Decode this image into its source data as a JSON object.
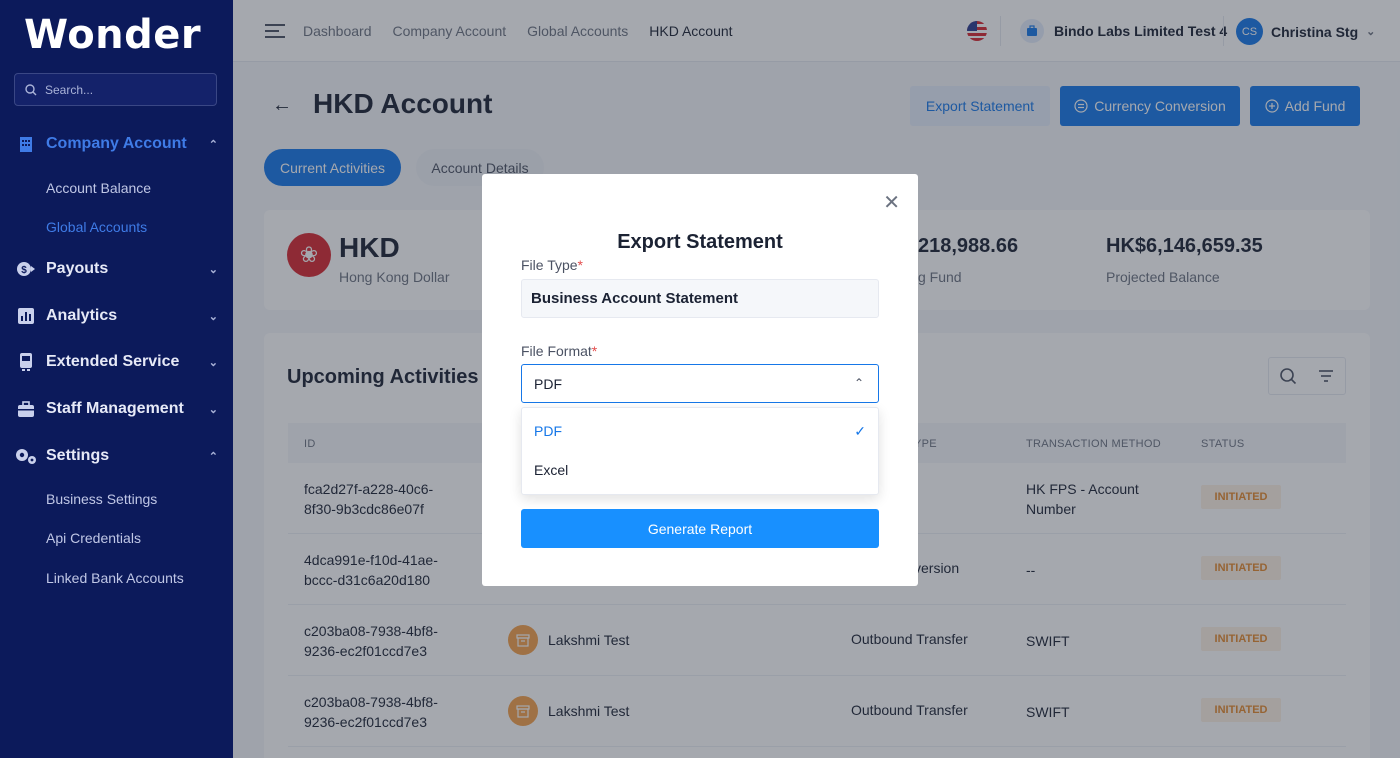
{
  "sidebar": {
    "logo": "Wonder",
    "search_placeholder": "Search...",
    "items": [
      {
        "label": "Company Account",
        "icon": "building-icon",
        "expanded": true
      },
      {
        "label": "Payouts",
        "icon": "money-icon"
      },
      {
        "label": "Analytics",
        "icon": "chart-icon"
      },
      {
        "label": "Extended Service",
        "icon": "service-icon"
      },
      {
        "label": "Staff Management",
        "icon": "staff-icon"
      },
      {
        "label": "Settings",
        "icon": "gears-icon",
        "expanded": true
      }
    ],
    "company_sub": [
      "Account Balance",
      "Global Accounts"
    ],
    "settings_sub": [
      "Business Settings",
      "Api Credentials",
      "Linked Bank Accounts"
    ]
  },
  "topbar": {
    "breadcrumbs": [
      "Dashboard",
      "Company Account",
      "Global Accounts",
      "HKD Account"
    ],
    "business": "Bindo Labs Limited Test 4",
    "user_initials": "CS",
    "user_name": "Christina Stg"
  },
  "page": {
    "title": "HKD Account",
    "buttons": {
      "export": "Export Statement",
      "conversion": "Currency Conversion",
      "add_fund": "Add Fund"
    },
    "tabs": [
      "Current Activities",
      "Account Details"
    ]
  },
  "balance": {
    "code": "HKD",
    "name": "Hong Kong Dollar",
    "amount2": "218,988.66",
    "label2": "g Fund",
    "amount3": "HK$6,146,659.35",
    "label3": "Projected Balance"
  },
  "activities": {
    "title": "Upcoming Activities",
    "headers": [
      "ID",
      "YPE",
      "TRANSACTION METHOD",
      "STATUS"
    ],
    "rows": [
      {
        "id1": "fca2d27f-a228-40c6-",
        "id2": "8f30-9b3cdc86e07f",
        "name": "",
        "type": "",
        "method1": "HK FPS - Account",
        "method2": "Number",
        "status": "INITIATED"
      },
      {
        "id1": "4dca991e-f10d-41ae-",
        "id2": "bccc-d31c6a20d180",
        "name": "",
        "type": "version",
        "method1": "--",
        "method2": "",
        "status": "INITIATED"
      },
      {
        "id1": "c203ba08-7938-4bf8-",
        "id2": "9236-ec2f01ccd7e3",
        "name": "Lakshmi Test",
        "type": "Outbound Transfer",
        "method1": "SWIFT",
        "method2": "",
        "status": "INITIATED"
      },
      {
        "id1": "c203ba08-7938-4bf8-",
        "id2": "9236-ec2f01ccd7e3",
        "name": "Lakshmi Test",
        "type": "Outbound Transfer",
        "method1": "SWIFT",
        "method2": "",
        "status": "INITIATED"
      }
    ]
  },
  "modal": {
    "title": "Export Statement",
    "file_type_label": "File Type",
    "file_type_value": "Business Account Statement",
    "file_format_label": "File Format",
    "file_format_value": "PDF",
    "options": [
      "PDF",
      "Excel"
    ],
    "selected_option": "PDF",
    "generate_label": "Generate Report",
    "required_mark": "*"
  },
  "colors": {
    "primary": "#1677e8",
    "sidebar": "#0c1a5b",
    "status": "#e68a2e"
  }
}
